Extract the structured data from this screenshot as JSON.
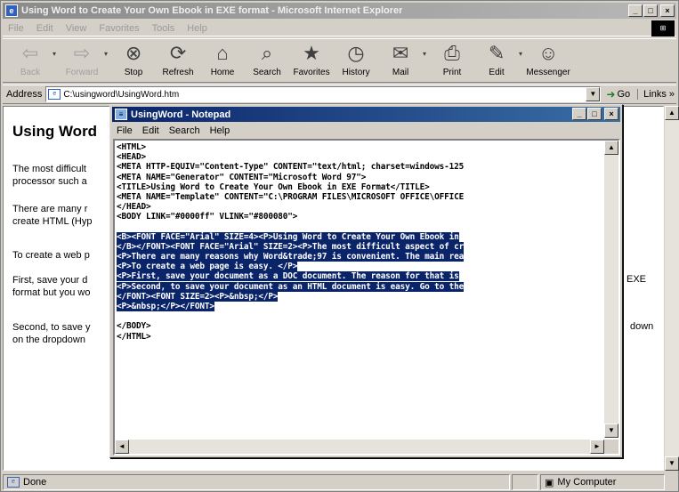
{
  "ie": {
    "title": "Using Word to Create Your Own Ebook in EXE format - Microsoft Internet Explorer",
    "window_buttons": {
      "minimize": "_",
      "maximize": "□",
      "close": "×"
    },
    "menu": [
      "File",
      "Edit",
      "View",
      "Favorites",
      "Tools",
      "Help"
    ],
    "toolbar": [
      {
        "label": "Back",
        "icon": "back-arrow-icon",
        "glyph": "⇦",
        "disabled": true
      },
      {
        "label": "Forward",
        "icon": "forward-arrow-icon",
        "glyph": "⇨",
        "disabled": true
      },
      {
        "label": "Stop",
        "icon": "stop-icon",
        "glyph": "⊗",
        "disabled": false
      },
      {
        "label": "Refresh",
        "icon": "refresh-icon",
        "glyph": "⟳",
        "disabled": false
      },
      {
        "label": "Home",
        "icon": "home-icon",
        "glyph": "⌂",
        "disabled": false
      },
      {
        "label": "Search",
        "icon": "search-icon",
        "glyph": "⌕",
        "disabled": false
      },
      {
        "label": "Favorites",
        "icon": "favorites-icon",
        "glyph": "★",
        "disabled": false
      },
      {
        "label": "History",
        "icon": "history-icon",
        "glyph": "◷",
        "disabled": false
      },
      {
        "label": "Mail",
        "icon": "mail-icon",
        "glyph": "✉",
        "disabled": false
      },
      {
        "label": "Print",
        "icon": "print-icon",
        "glyph": "⎙",
        "disabled": false
      },
      {
        "label": "Edit",
        "icon": "edit-icon",
        "glyph": "✎",
        "disabled": false
      },
      {
        "label": "Messenger",
        "icon": "messenger-icon",
        "glyph": "☺",
        "disabled": false
      }
    ],
    "address": {
      "label": "Address",
      "value": "C:\\usingword\\UsingWord.htm",
      "go": "Go",
      "links": "Links »"
    },
    "page": {
      "heading": "Using Word",
      "paragraphs": [
        [
          "The most difficult",
          "processor such a"
        ],
        [
          "There are many r",
          "create HTML (Hyp"
        ],
        [
          "To create a web p"
        ],
        [
          "First, save your d",
          "format but you wo"
        ],
        [
          "Second, to save y",
          "on the dropdown"
        ]
      ],
      "right_fragments": [
        "EXE",
        "down"
      ]
    },
    "status": {
      "left": "Done",
      "zone": "My Computer"
    }
  },
  "notepad": {
    "title": "UsingWord - Notepad",
    "menu": [
      "File",
      "Edit",
      "Search",
      "Help"
    ],
    "lines": [
      {
        "text": "<HTML>",
        "selected": false
      },
      {
        "text": "<HEAD>",
        "selected": false
      },
      {
        "text": "<META HTTP-EQUIV=\"Content-Type\" CONTENT=\"text/html; charset=windows-125",
        "selected": false
      },
      {
        "text": "<META NAME=\"Generator\" CONTENT=\"Microsoft Word 97\">",
        "selected": false
      },
      {
        "text": "<TITLE>Using Word to Create Your Own Ebook in EXE Format</TITLE>",
        "selected": false
      },
      {
        "text": "<META NAME=\"Template\" CONTENT=\"C:\\PROGRAM FILES\\MICROSOFT OFFICE\\OFFICE",
        "selected": false
      },
      {
        "text": "</HEAD>",
        "selected": false
      },
      {
        "text": "<BODY LINK=\"#0000ff\" VLINK=\"#800080\">",
        "selected": false
      },
      {
        "text": "",
        "selected": false
      },
      {
        "text": "<B><FONT FACE=\"Arial\" SIZE=4><P>Using Word to Create Your Own Ebook in",
        "selected": true
      },
      {
        "text": "</B></FONT><FONT FACE=\"Arial\" SIZE=2><P>The most difficult aspect of cr",
        "selected": true
      },
      {
        "text": "<P>There are many reasons why Word&trade;97 is convenient. The main rea",
        "selected": true
      },
      {
        "text": "<P>To create a web page is easy. </P>",
        "selected": true
      },
      {
        "text": "<P>First, save your document as a DOC document. The reason for that is",
        "selected": true
      },
      {
        "text": "<P>Second, to save your document as an HTML document is easy. Go to the",
        "selected": true
      },
      {
        "text": "</FONT><FONT SIZE=2><P>&nbsp;</P>",
        "selected": true
      },
      {
        "text": "<P>&nbsp;</P></FONT>",
        "selected": true
      },
      {
        "text": "",
        "selected": false
      },
      {
        "text": "</BODY>",
        "selected": false
      },
      {
        "text": "</HTML>",
        "selected": false
      }
    ]
  },
  "colors": {
    "selection": "#0a246a",
    "notepad_titlebar": "#0a246a"
  }
}
